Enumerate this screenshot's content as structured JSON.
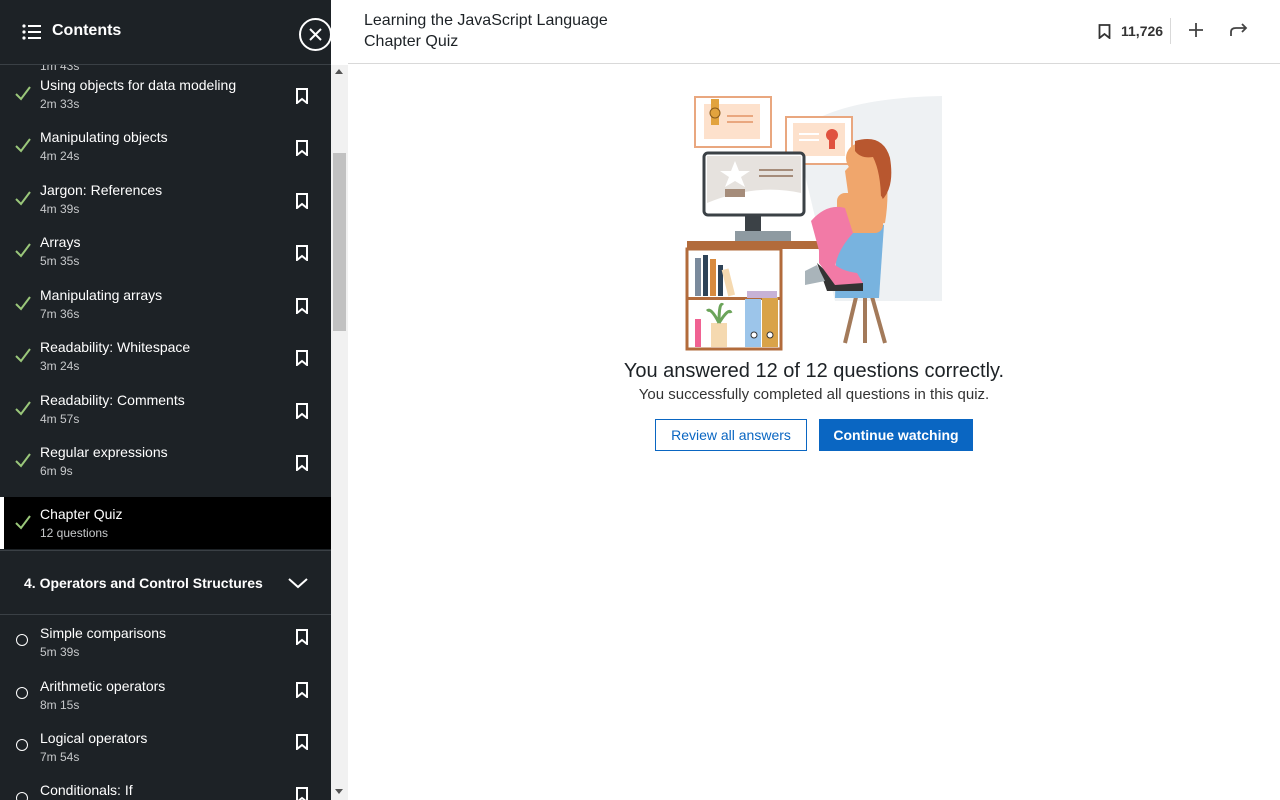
{
  "sidebar": {
    "title": "Contents",
    "peek_text": "1m 43s",
    "items": [
      {
        "title": "Using objects for data modeling",
        "sub": "2m 33s",
        "status": "done"
      },
      {
        "title": "Manipulating objects",
        "sub": "4m 24s",
        "status": "done"
      },
      {
        "title": "Jargon: References",
        "sub": "4m 39s",
        "status": "done"
      },
      {
        "title": "Arrays",
        "sub": "5m 35s",
        "status": "done"
      },
      {
        "title": "Manipulating arrays",
        "sub": "7m 36s",
        "status": "done"
      },
      {
        "title": "Readability: Whitespace",
        "sub": "3m 24s",
        "status": "done"
      },
      {
        "title": "Readability: Comments",
        "sub": "4m 57s",
        "status": "done"
      },
      {
        "title": "Regular expressions",
        "sub": "6m 9s",
        "status": "done"
      },
      {
        "title": "Chapter Quiz",
        "sub": "12 questions",
        "status": "done"
      }
    ],
    "section": {
      "title": "4. Operators and Control Structures"
    },
    "section_items": [
      {
        "title": "Simple comparisons",
        "sub": "5m 39s",
        "status": "todo"
      },
      {
        "title": "Arithmetic operators",
        "sub": "8m 15s",
        "status": "todo"
      },
      {
        "title": "Logical operators",
        "sub": "7m 54s",
        "status": "todo"
      },
      {
        "title": "Conditionals: If",
        "sub": "",
        "status": "todo"
      }
    ]
  },
  "header": {
    "course_title": "Learning the JavaScript Language",
    "chapter_title": "Chapter Quiz",
    "save_count": "11,726"
  },
  "quiz": {
    "result_text": "You answered 12 of 12 questions correctly.",
    "sub_text": "You successfully completed all questions in this quiz.",
    "review_label": "Review all answers",
    "continue_label": "Continue watching"
  },
  "colors": {
    "sidebar_bg": "#1d2226",
    "check": "#9ac77a",
    "accent": "#0a66c2"
  }
}
